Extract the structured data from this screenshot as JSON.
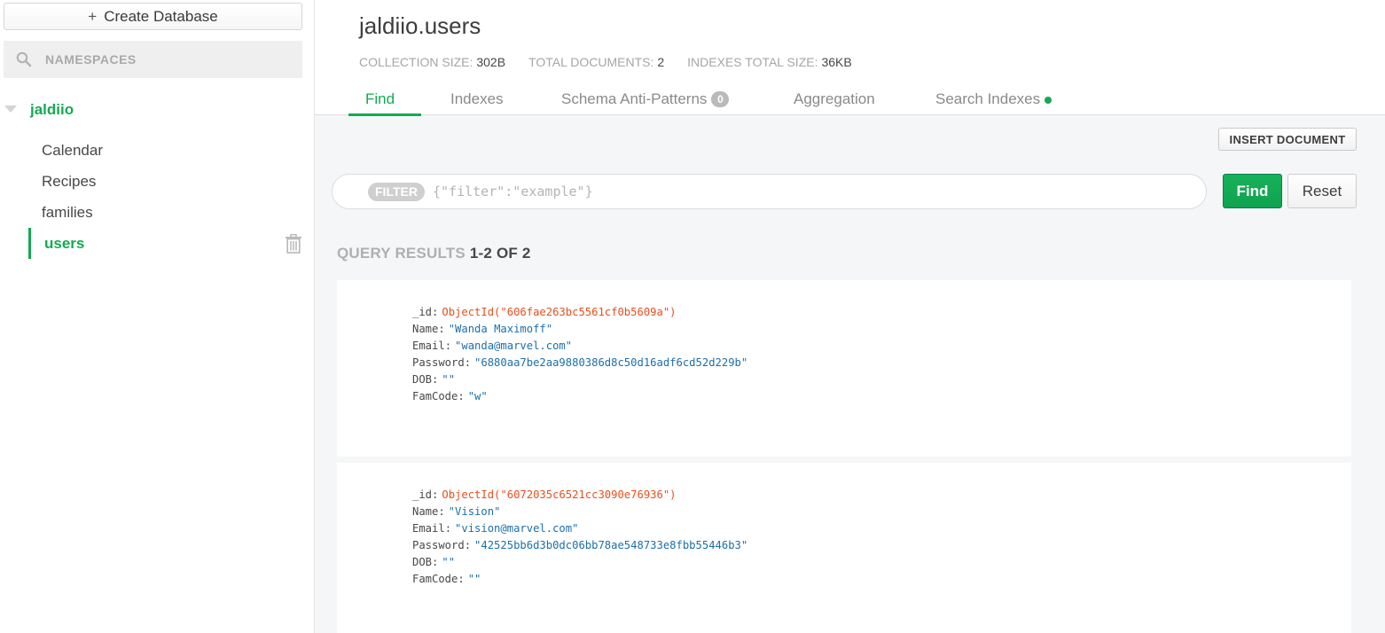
{
  "sidebar": {
    "create_db_label": "Create Database",
    "search_placeholder": "NAMESPACES",
    "database": "jaldiio",
    "collections": [
      "Calendar",
      "Recipes",
      "families",
      "users"
    ],
    "active_collection": "users"
  },
  "header": {
    "title": "jaldiio.users",
    "stats": {
      "collection_size_label": "COLLECTION SIZE:",
      "collection_size": "302B",
      "total_docs_label": "TOTAL DOCUMENTS:",
      "total_docs": "2",
      "indexes_size_label": "INDEXES TOTAL SIZE:",
      "indexes_size": "36KB"
    },
    "tabs": [
      {
        "label": "Find"
      },
      {
        "label": "Indexes"
      },
      {
        "label": "Schema Anti-Patterns",
        "badge": "0"
      },
      {
        "label": "Aggregation"
      },
      {
        "label": "Search Indexes"
      }
    ]
  },
  "toolbar": {
    "insert_label": "INSERT DOCUMENT",
    "filter_pill": "FILTER",
    "filter_placeholder": "{\"filter\":\"example\"}",
    "find_label": "Find",
    "reset_label": "Reset"
  },
  "results": {
    "label": "QUERY RESULTS",
    "count": "1-2 OF 2"
  },
  "documents": [
    {
      "id_key": "_id",
      "id_value": "ObjectId(\"606fae263bc5561cf0b5609a\")",
      "fields": [
        {
          "key": "Name",
          "value": "\"Wanda Maximoff\""
        },
        {
          "key": "Email",
          "value": "\"wanda@marvel.com\""
        },
        {
          "key": "Password",
          "value": "\"6880aa7be2aa9880386d8c50d16adf6cd52d229b\""
        },
        {
          "key": "DOB",
          "value": "\"\""
        },
        {
          "key": "FamCode",
          "value": "\"w\""
        }
      ]
    },
    {
      "id_key": "_id",
      "id_value": "ObjectId(\"6072035c6521cc3090e76936\")",
      "fields": [
        {
          "key": "Name",
          "value": "\"Vision\""
        },
        {
          "key": "Email",
          "value": "\"vision@marvel.com\""
        },
        {
          "key": "Password",
          "value": "\"42525bb6d3b0dc06bb78ae548733e8fbb55446b3\""
        },
        {
          "key": "DOB",
          "value": "\"\""
        },
        {
          "key": "FamCode",
          "value": "\"\""
        }
      ]
    }
  ],
  "icons": {
    "search": "search-icon",
    "caret": "caret-down-icon",
    "trash": "trash-icon",
    "plus": "plus-icon"
  },
  "colors": {
    "accent": "#13aa52",
    "object_id": "#e8501d",
    "string": "#1c6faa"
  }
}
